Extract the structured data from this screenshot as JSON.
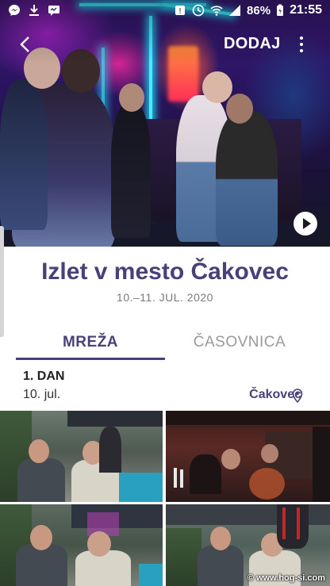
{
  "status_bar": {
    "battery": "86%",
    "time": "21:55"
  },
  "toolbar": {
    "add_label": "DODAJ"
  },
  "story": {
    "title": "Izlet v mesto Čakovec",
    "dates": "10.–11. JUL. 2020"
  },
  "tabs": [
    {
      "label": "MREŽA",
      "selected": true
    },
    {
      "label": "ČASOVNICA",
      "selected": false
    }
  ],
  "day": {
    "label": "1. DAN",
    "date": "10. jul.",
    "location": "Čakovec"
  },
  "watermark": "© www.hog-si.com",
  "colors": {
    "accent": "#4b3f7a",
    "neon": "#3ff0ff"
  }
}
